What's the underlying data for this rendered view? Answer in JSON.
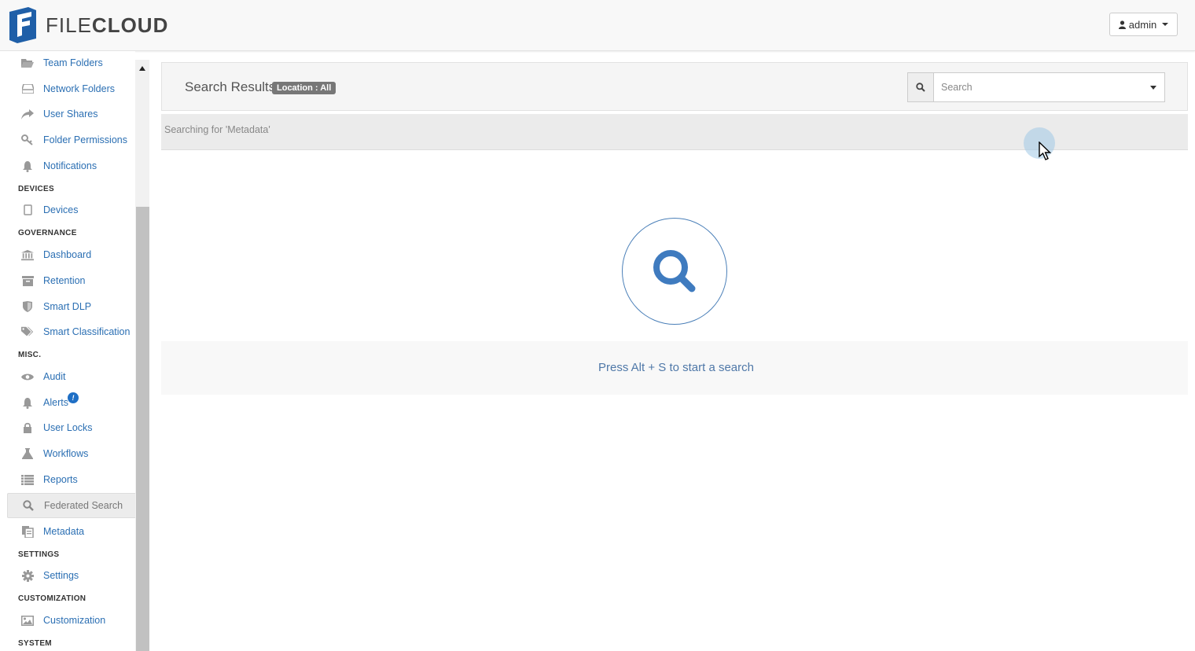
{
  "header": {
    "logo_text_light": "FILE",
    "logo_text_bold": "CLOUD",
    "user_label": "admin",
    "brand_color": "#1f5fa8"
  },
  "sidebar": {
    "items": [
      {
        "label": "Team Folders",
        "icon": "folder-open-icon"
      },
      {
        "label": "Network Folders",
        "icon": "hdd-icon"
      },
      {
        "label": "User Shares",
        "icon": "share-icon"
      },
      {
        "label": "Folder Permissions",
        "icon": "key-icon"
      },
      {
        "label": "Notifications",
        "icon": "bell-icon"
      },
      {
        "label": "Devices",
        "icon": "tablet-icon"
      },
      {
        "label": "Dashboard",
        "icon": "bank-icon"
      },
      {
        "label": "Retention",
        "icon": "archive-icon"
      },
      {
        "label": "Smart DLP",
        "icon": "shield-icon"
      },
      {
        "label": "Smart Classification",
        "icon": "tags-icon"
      },
      {
        "label": "Audit",
        "icon": "eye-icon"
      },
      {
        "label": "Alerts",
        "icon": "bell-icon",
        "badge": "!"
      },
      {
        "label": "User Locks",
        "icon": "lock-icon"
      },
      {
        "label": "Workflows",
        "icon": "flask-icon"
      },
      {
        "label": "Reports",
        "icon": "list-icon"
      },
      {
        "label": "Federated Search",
        "icon": "search-icon",
        "active": true
      },
      {
        "label": "Metadata",
        "icon": "files-icon"
      },
      {
        "label": "Settings",
        "icon": "gear-icon"
      },
      {
        "label": "Customization",
        "icon": "image-icon"
      }
    ],
    "sections": {
      "devices": "DEVICES",
      "governance": "GOVERNANCE",
      "misc": "MISC.",
      "settings": "SETTINGS",
      "customization": "CUSTOMIZATION",
      "system": "SYSTEM"
    }
  },
  "main": {
    "title": "Search Results",
    "location_badge": "Location : All",
    "search_placeholder": "Search",
    "searching_text": "Searching for 'Metadata'",
    "hint_text": "Press Alt + S to start a search"
  }
}
